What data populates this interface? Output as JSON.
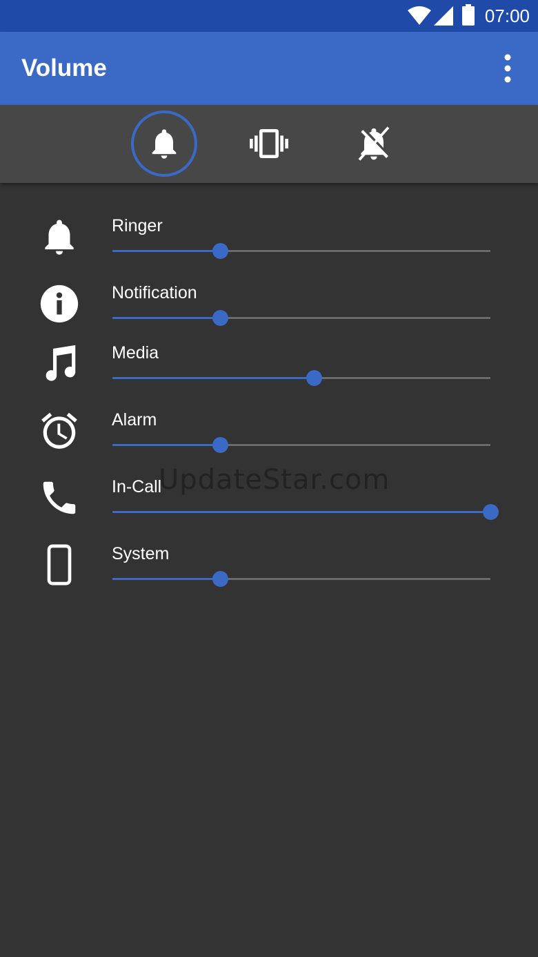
{
  "status_bar": {
    "time": "07:00",
    "icons": [
      "wifi-icon",
      "signal-icon",
      "battery-icon"
    ]
  },
  "app_bar": {
    "title": "Volume",
    "menu_icon": "more-vert-icon"
  },
  "modes": [
    {
      "name": "ring",
      "icon": "bell-icon",
      "selected": true
    },
    {
      "name": "vibrate",
      "icon": "vibrate-icon",
      "selected": false
    },
    {
      "name": "silent",
      "icon": "bell-off-icon",
      "selected": false
    }
  ],
  "volumes": [
    {
      "label": "Ringer",
      "icon": "bell-icon",
      "level": 0.285
    },
    {
      "label": "Notification",
      "icon": "info-icon",
      "level": 0.285
    },
    {
      "label": "Media",
      "icon": "music-note-icon",
      "level": 0.533
    },
    {
      "label": "Alarm",
      "icon": "alarm-clock-icon",
      "level": 0.285
    },
    {
      "label": "In-Call",
      "icon": "phone-icon",
      "level": 1.0
    },
    {
      "label": "System",
      "icon": "smartphone-icon",
      "level": 0.285
    }
  ],
  "watermark": "UpdateStar.com",
  "colors": {
    "status_bar": "#1f4aa8",
    "app_bar": "#3a6ac6",
    "accent": "#3a6ac6",
    "background": "#333333",
    "mode_bar": "#474747"
  }
}
